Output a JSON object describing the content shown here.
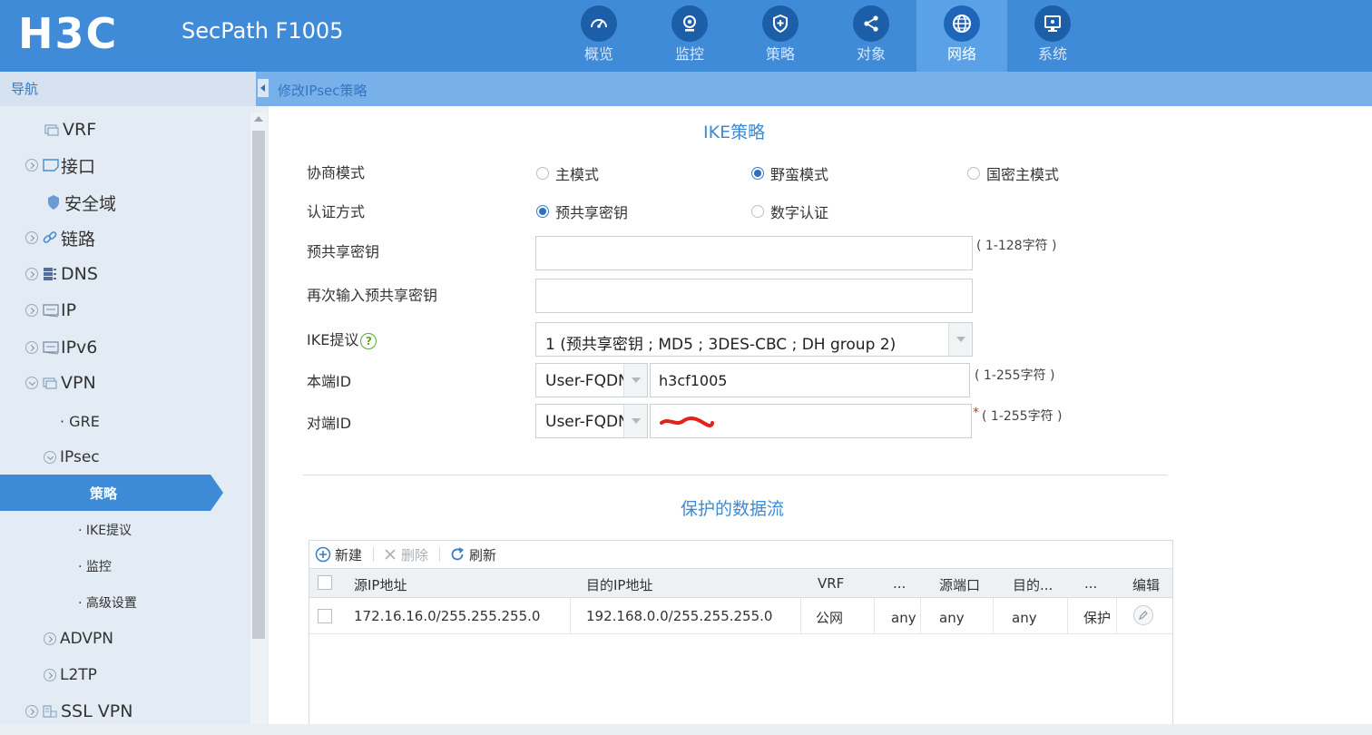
{
  "header": {
    "logo": "H3C",
    "product": "SecPath F1005",
    "nav": [
      {
        "label": "概览",
        "icon": "gauge-icon"
      },
      {
        "label": "监控",
        "icon": "webcam-icon"
      },
      {
        "label": "策略",
        "icon": "shield-icon"
      },
      {
        "label": "对象",
        "icon": "share-icon"
      },
      {
        "label": "网络",
        "icon": "globe-icon",
        "active": true
      },
      {
        "label": "系统",
        "icon": "monitor-icon"
      }
    ]
  },
  "sidebar": {
    "title": "导航",
    "items": {
      "vrf": "VRF",
      "interface": "接口",
      "security_zone": "安全域",
      "link": "链路",
      "dns": "DNS",
      "ip": "IP",
      "ipv6": "IPv6",
      "vpn": "VPN",
      "gre": "· GRE",
      "ipsec": "IPsec",
      "policy": "策略",
      "ike_proposal": "· IKE提议",
      "monitor": "· 监控",
      "advanced": "· 高级设置",
      "advpn": "ADVPN",
      "l2tp": "L2TP",
      "sslvpn": "SSL VPN"
    }
  },
  "breadcrumb": "修改IPsec策略",
  "ike": {
    "section_title": "IKE策略",
    "mode_label": "协商模式",
    "mode_options": [
      "主模式",
      "野蛮模式",
      "国密主模式"
    ],
    "mode_selected": "野蛮模式",
    "auth_label": "认证方式",
    "auth_options": [
      "预共享密钥",
      "数字认证"
    ],
    "auth_selected": "预共享密钥",
    "psk_label": "预共享密钥",
    "psk_hint": "( 1-128字符 )",
    "psk_confirm_label": "再次输入预共享密钥",
    "proposal_label": "IKE提议",
    "proposal_value": "1 (预共享密钥 ; MD5 ; 3DES-CBC ; DH group 2)",
    "local_id_label": "本端ID",
    "local_id_type": "User-FQDN",
    "local_id_value": "h3cf1005",
    "local_id_hint": "( 1-255字符 )",
    "remote_id_label": "对端ID",
    "remote_id_type": "User-FQDN",
    "remote_id_hint": "( 1-255字符 )",
    "required_mark": "*"
  },
  "flows": {
    "section_title": "保护的数据流",
    "toolbar": {
      "new": "新建",
      "delete": "删除",
      "refresh": "刷新"
    },
    "columns": [
      "源IP地址",
      "目的IP地址",
      "VRF",
      "...",
      "源端口",
      "目的...",
      "...",
      "编辑"
    ],
    "rows": [
      [
        "172.16.16.0/255.255.255.0",
        "192.168.0.0/255.255.255.0",
        "公网",
        "any",
        "any",
        "any",
        "保护"
      ]
    ]
  },
  "colors": {
    "header_bg": "#3f8bd8",
    "accent": "#3d8ad6",
    "section_title": "#3b8ad5"
  }
}
